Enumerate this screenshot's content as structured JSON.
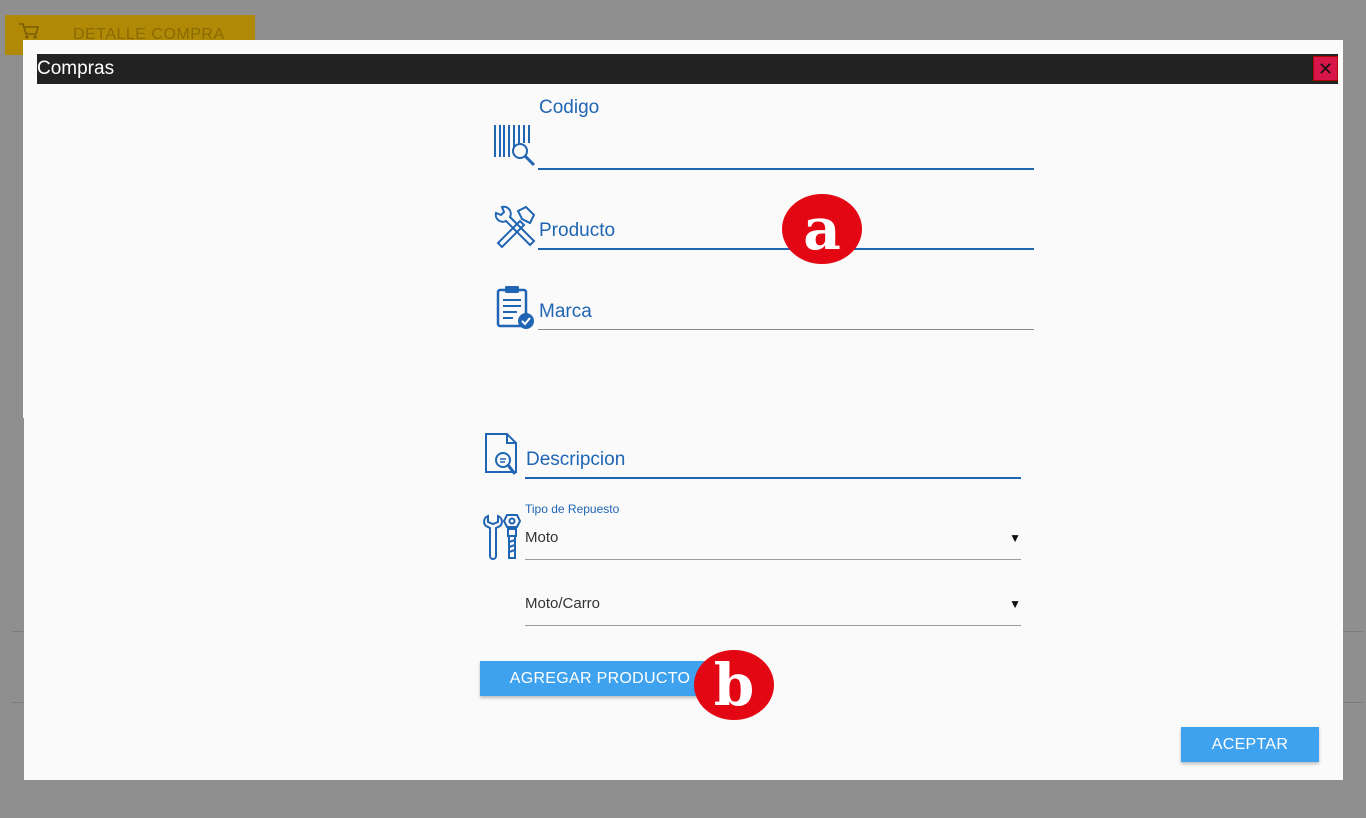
{
  "background": {
    "detalle_button": "DETALLE COMPRA"
  },
  "dialog": {
    "title": "Compras",
    "close_symbol": "✕",
    "fields": {
      "codigo": "Codigo",
      "producto": "Producto",
      "marca": "Marca",
      "descripcion": "Descripcion"
    },
    "tipo_repuesto": {
      "label": "Tipo de Repuesto",
      "value": "Moto"
    },
    "vehicle_select": {
      "value": "Moto/Carro"
    },
    "select_arrow": "▼",
    "add_product_button": "AGREGAR PRODUCTO",
    "accept_button": "ACEPTAR"
  },
  "annotations": {
    "a": "a",
    "b": "b"
  },
  "colors": {
    "accent_blue": "#1f65b3",
    "button_blue": "#3fa2ef",
    "marker_red": "#e30613",
    "titlebar": "#222222",
    "close_red": "#d9164a"
  },
  "icons": [
    "cart-icon",
    "barcode-search-icon",
    "tools-icon",
    "clipboard-check-icon",
    "document-search-icon",
    "wrench-bolt-icon",
    "close-icon"
  ]
}
